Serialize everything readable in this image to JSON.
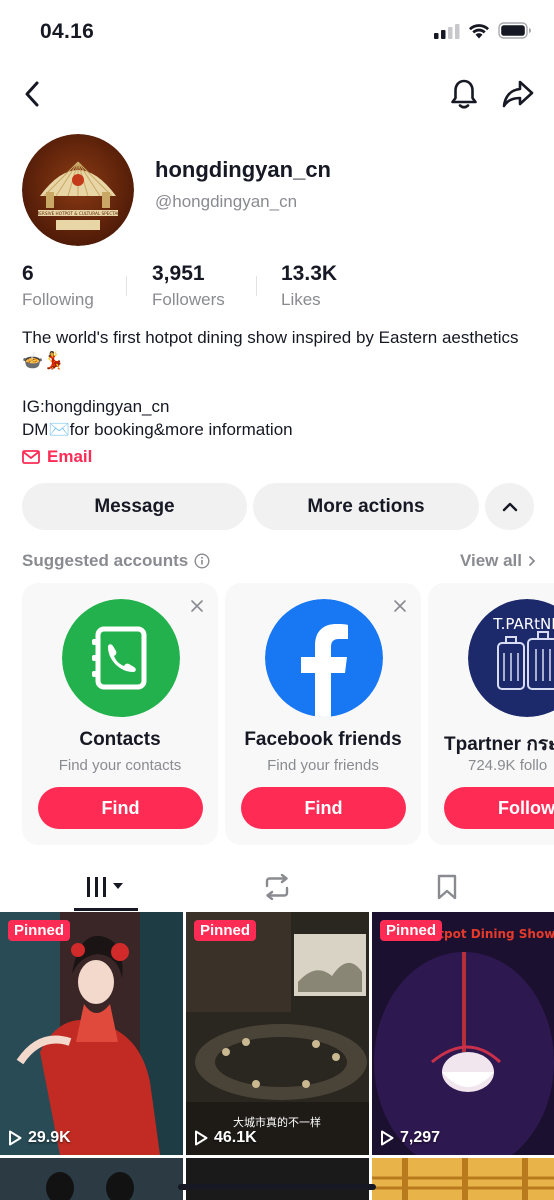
{
  "status": {
    "time": "04.16"
  },
  "profile": {
    "username": "hongdingyan_cn",
    "handle": "@hongdingyan_cn",
    "avatar_text": "IMMERSIVE HOTPOT & CULTURAL SPECTACLE",
    "stats": [
      {
        "value": "6",
        "label": "Following"
      },
      {
        "value": "3,951",
        "label": "Followers"
      },
      {
        "value": "13.3K",
        "label": "Likes"
      }
    ],
    "bio": "The world's first hotpot dining show inspired by Eastern aesthetics🍲💃\n\nIG:hongdingyan_cn\nDM✉️for booking&more information",
    "email_label": "Email"
  },
  "actions": {
    "message": "Message",
    "more": "More actions"
  },
  "suggested": {
    "title": "Suggested accounts",
    "view_all": "View all",
    "cards": [
      {
        "name": "Contacts",
        "sub": "Find your contacts",
        "button": "Find",
        "icon": "contacts-icon",
        "color": "#22b14c"
      },
      {
        "name": "Facebook friends",
        "sub": "Find your friends",
        "button": "Find",
        "icon": "facebook-icon",
        "color": "#1877f2"
      },
      {
        "name": "Tpartner กระ",
        "sub": "724.9K follo",
        "button": "Follow",
        "icon": "tpartner-avatar",
        "color": "#1c2a6b",
        "avatar_text": "T.PARtNE"
      }
    ]
  },
  "videos": [
    {
      "badge": "Pinned",
      "views": "29.9K"
    },
    {
      "badge": "Pinned",
      "views": "46.1K",
      "caption": "大城市真的不一样"
    },
    {
      "badge": "Pinned",
      "views": "7,297",
      "overlay": "First Hotpot Dining Show"
    }
  ],
  "colors": {
    "accent": "#fe2c55",
    "text": "#161823",
    "muted": "#8a8b91",
    "surface": "#f1f1f2"
  }
}
